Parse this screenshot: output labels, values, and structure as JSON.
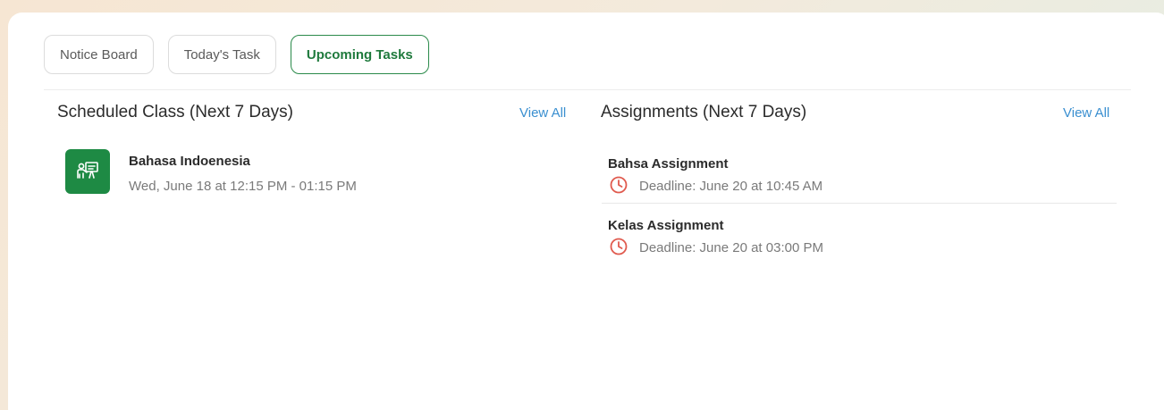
{
  "tabs": [
    {
      "label": "Notice Board",
      "active": false
    },
    {
      "label": "Today's Task",
      "active": false
    },
    {
      "label": "Upcoming Tasks",
      "active": true
    }
  ],
  "scheduled": {
    "title": "Scheduled Class (Next 7 Days)",
    "view_all": "View All",
    "items": [
      {
        "title": "Bahasa Indoenesia",
        "time": "Wed, June 18 at 12:15 PM - 01:15 PM",
        "icon": "teacher-board-icon"
      }
    ]
  },
  "assignments": {
    "title": "Assignments (Next 7 Days)",
    "view_all": "View All",
    "items": [
      {
        "title": "Bahsa Assignment",
        "deadline": "Deadline: June 20 at 10:45 AM",
        "icon": "clock-icon"
      },
      {
        "title": "Kelas Assignment",
        "deadline": "Deadline: June 20 at 03:00 PM",
        "icon": "clock-icon"
      }
    ]
  },
  "colors": {
    "accent_green": "#1e8a44",
    "link_blue": "#3a8fd0",
    "deadline_red": "#e05a4e"
  }
}
